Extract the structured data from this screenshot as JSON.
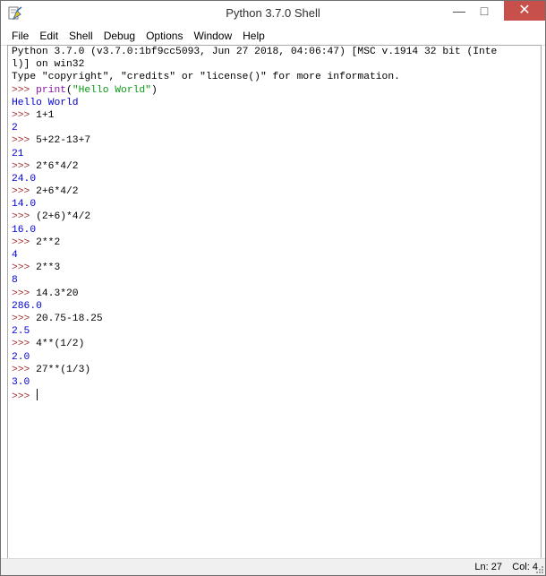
{
  "window": {
    "title": "Python 3.7.0 Shell",
    "controls": {
      "minimize": "—",
      "maximize": "□",
      "close": "✕"
    },
    "icon": "idle-python-icon"
  },
  "menu": {
    "items": [
      "File",
      "Edit",
      "Shell",
      "Debug",
      "Options",
      "Window",
      "Help"
    ]
  },
  "shell": {
    "lines": [
      {
        "type": "banner",
        "text": "Python 3.7.0 (v3.7.0:1bf9cc5093, Jun 27 2018, 04:06:47) [MSC v.1914 32 bit (Inte"
      },
      {
        "type": "banner",
        "text": "l)] on win32"
      },
      {
        "type": "banner",
        "text": "Type \"copyright\", \"credits\" or \"license()\" for more information."
      },
      {
        "type": "print_cmd",
        "prompt": ">>> ",
        "builtin": "print",
        "paren_open": "(",
        "string": "\"Hello World\"",
        "paren_close": ")"
      },
      {
        "type": "output",
        "text": "Hello World"
      },
      {
        "type": "cmd",
        "prompt": ">>> ",
        "text": "1+1"
      },
      {
        "type": "output",
        "text": "2"
      },
      {
        "type": "cmd",
        "prompt": ">>> ",
        "text": "5+22-13+7"
      },
      {
        "type": "output",
        "text": "21"
      },
      {
        "type": "cmd",
        "prompt": ">>> ",
        "text": "2*6*4/2"
      },
      {
        "type": "output",
        "text": "24.0"
      },
      {
        "type": "cmd",
        "prompt": ">>> ",
        "text": "2+6*4/2"
      },
      {
        "type": "output",
        "text": "14.0"
      },
      {
        "type": "cmd",
        "prompt": ">>> ",
        "text": "(2+6)*4/2"
      },
      {
        "type": "output",
        "text": "16.0"
      },
      {
        "type": "cmd",
        "prompt": ">>> ",
        "text": "2**2"
      },
      {
        "type": "output",
        "text": "4"
      },
      {
        "type": "cmd",
        "prompt": ">>> ",
        "text": "2**3"
      },
      {
        "type": "output",
        "text": "8"
      },
      {
        "type": "cmd",
        "prompt": ">>> ",
        "text": "14.3*20"
      },
      {
        "type": "output",
        "text": "286.0"
      },
      {
        "type": "cmd",
        "prompt": ">>> ",
        "text": "20.75-18.25"
      },
      {
        "type": "output",
        "text": "2.5"
      },
      {
        "type": "cmd",
        "prompt": ">>> ",
        "text": "4**(1/2)"
      },
      {
        "type": "output",
        "text": "2.0"
      },
      {
        "type": "cmd",
        "prompt": ">>> ",
        "text": "27**(1/3)"
      },
      {
        "type": "output",
        "text": "3.0"
      },
      {
        "type": "current",
        "prompt": ">>> ",
        "text": ""
      }
    ]
  },
  "status": {
    "ln": "Ln: 27",
    "col": "Col: 4"
  },
  "colors": {
    "output": "#0000d4",
    "prompt": "#9e2e2e",
    "builtin": "#8c0ea8",
    "string": "#0a9a12",
    "close_button": "#c7504b"
  }
}
